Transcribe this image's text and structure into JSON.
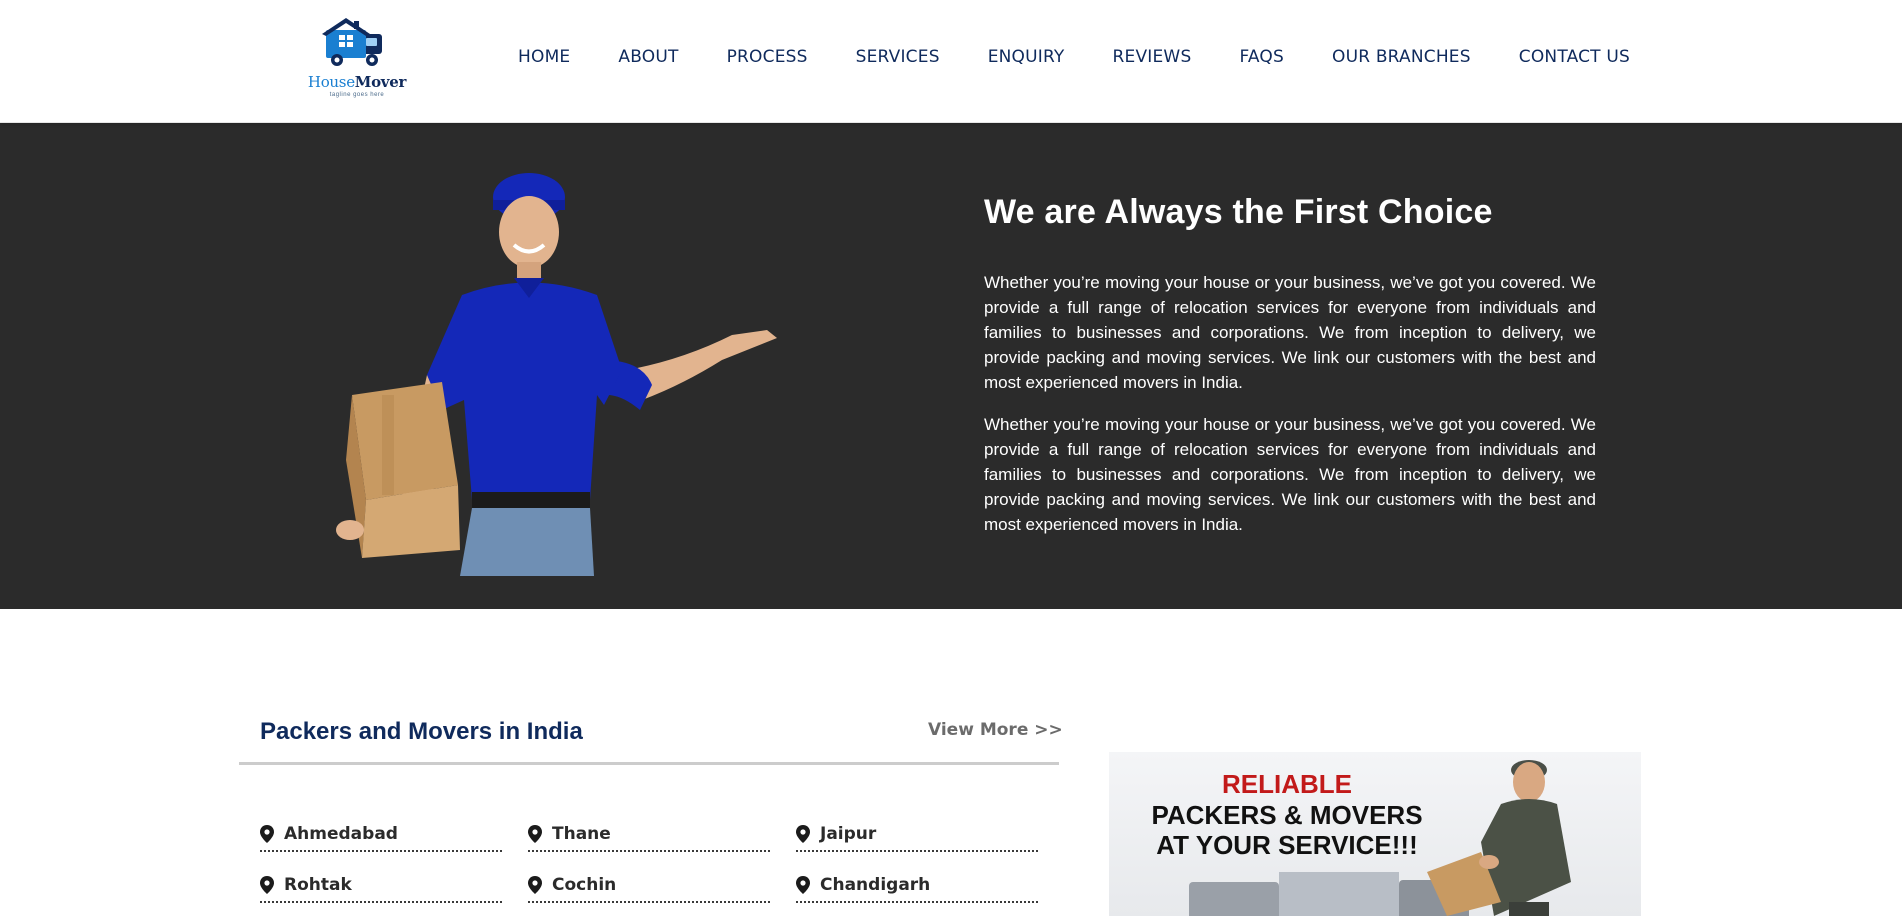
{
  "brand": {
    "name_part1": "House",
    "name_part2": "Mover",
    "tagline": "tagline goes here"
  },
  "nav": [
    {
      "label": "HOME"
    },
    {
      "label": "ABOUT"
    },
    {
      "label": "PROCESS"
    },
    {
      "label": "SERVICES"
    },
    {
      "label": "ENQUIRY"
    },
    {
      "label": "REVIEWS"
    },
    {
      "label": "FAQS"
    },
    {
      "label": "OUR BRANCHES"
    },
    {
      "label": "CONTACT US"
    }
  ],
  "hero": {
    "title": "We are Always the First Choice",
    "paragraphs": [
      "Whether you’re moving your house or your business, we’ve got you covered. We provide a full range of relocation services for everyone from individuals and families to businesses and corporations. We from inception to delivery, we provide packing and moving services. We link our customers with the best and most experienced movers in India.",
      "Whether you’re moving your house or your business, we’ve got you covered. We provide a full range of relocation services for everyone from individuals and families to businesses and corporations. We from inception to delivery, we provide packing and moving services. We link our customers with the best and most experienced movers in India."
    ],
    "colors": {
      "background": "#2b2b2b",
      "shirt": "#1428b8"
    }
  },
  "packers": {
    "title": "Packers and Movers in India",
    "view_more": "View More >>",
    "cities": [
      "Ahmedabad",
      "Thane",
      "Jaipur",
      "Rohtak",
      "Cochin",
      "Chandigarh"
    ],
    "pin_icon": "map-pin-icon"
  },
  "promo": {
    "line1": "RELIABLE",
    "line2": "PACKERS & MOVERS",
    "line3": "AT YOUR SERVICE!!!",
    "colors": {
      "accent": "#c21a1a"
    }
  },
  "colors": {
    "navy": "#0f2a5c",
    "logo_blue": "#1a7fd1"
  }
}
